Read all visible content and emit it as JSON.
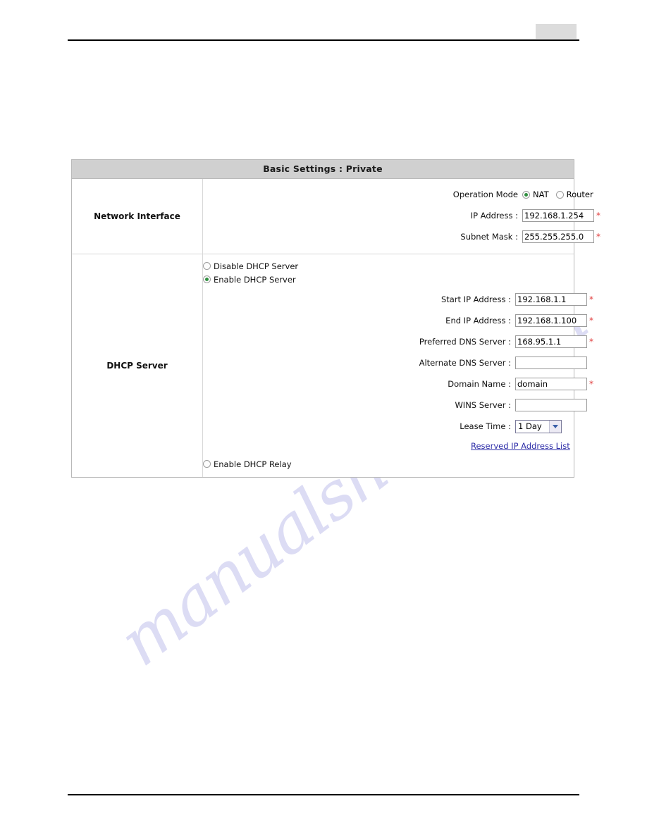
{
  "page": {
    "header_placeholder": "",
    "watermark": "manualshive.com"
  },
  "panel": {
    "title": "Basic Settings : Private",
    "required_marker": "*",
    "sections": [
      {
        "label": "Network Interface",
        "operation_mode": {
          "label": "Operation Mode",
          "options": [
            {
              "label": "NAT",
              "selected": true
            },
            {
              "label": "Router",
              "selected": false
            }
          ]
        },
        "fields": [
          {
            "label": "IP Address :",
            "value": "192.168.1.254",
            "required": true
          },
          {
            "label": "Subnet Mask :",
            "value": "255.255.255.0",
            "required": true
          }
        ]
      },
      {
        "label": "DHCP Server",
        "mode_options": [
          {
            "label": "Disable DHCP Server",
            "selected": false
          },
          {
            "label": "Enable DHCP Server",
            "selected": true
          }
        ],
        "fields": [
          {
            "label": "Start IP Address :",
            "value": "192.168.1.1",
            "required": true
          },
          {
            "label": "End IP Address :",
            "value": "192.168.1.100",
            "required": true
          },
          {
            "label": "Preferred DNS Server :",
            "value": "168.95.1.1",
            "required": true
          },
          {
            "label": "Alternate DNS Server :",
            "value": "",
            "required": false
          },
          {
            "label": "Domain Name :",
            "value": "domain",
            "required": true
          },
          {
            "label": "WINS Server :",
            "value": "",
            "required": false
          }
        ],
        "lease_time": {
          "label": "Lease Time :",
          "value": "1 Day",
          "options": [
            "1 Day"
          ]
        },
        "link": "Reserved IP Address List",
        "relay_option": {
          "label": "Enable DHCP Relay",
          "selected": false
        }
      }
    ]
  },
  "colors": {
    "title_bar": "#d0d0d0",
    "required": "#e03c3c",
    "link": "#2e2ea8",
    "radio_dot": "#2f8f3f",
    "watermark": "#c8c8ee"
  }
}
